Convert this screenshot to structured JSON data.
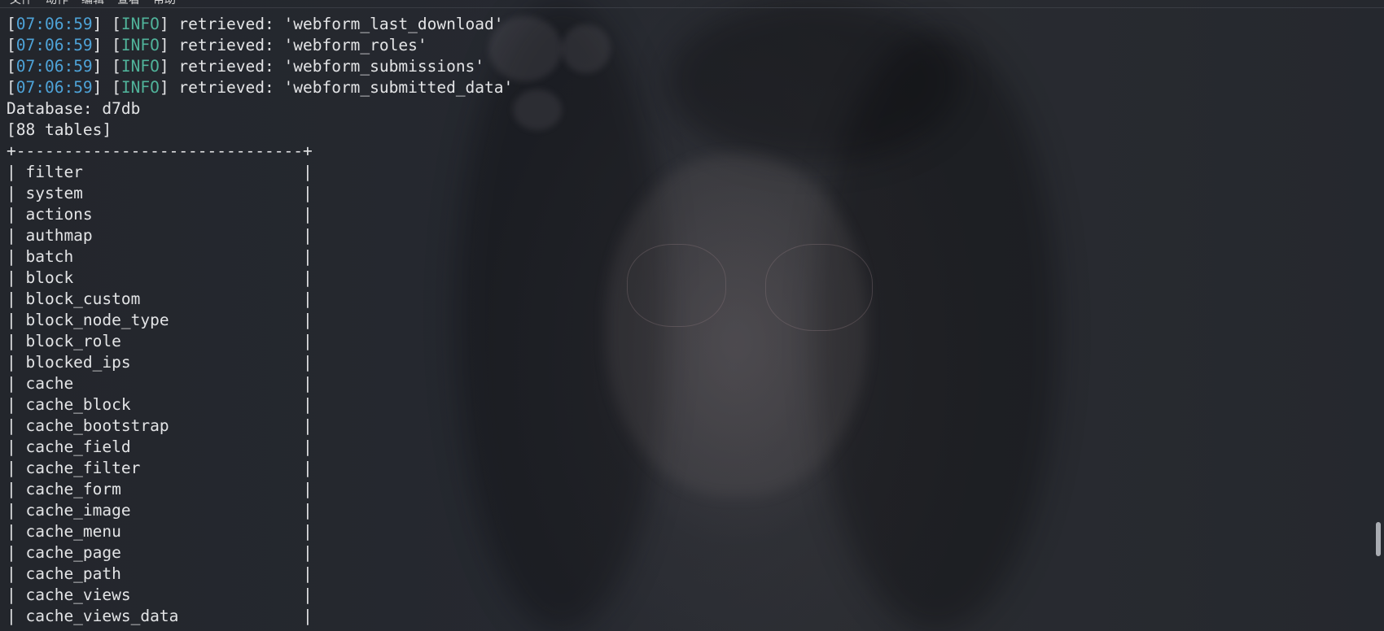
{
  "menu": [
    "文件",
    "动作",
    "编辑",
    "查看",
    "帮助"
  ],
  "colors": {
    "timestamp": "#4ea3d8",
    "level": "#50b39a",
    "text": "#e3e4e6",
    "background": "#23262c"
  },
  "log_lines": [
    {
      "time": "07:06:59",
      "level": "INFO",
      "message": "retrieved: 'webform_last_download'"
    },
    {
      "time": "07:06:59",
      "level": "INFO",
      "message": "retrieved: 'webform_roles'"
    },
    {
      "time": "07:06:59",
      "level": "INFO",
      "message": "retrieved: 'webform_submissions'"
    },
    {
      "time": "07:06:59",
      "level": "INFO",
      "message": "retrieved: 'webform_submitted_data'"
    }
  ],
  "database_line": "Database: d7db",
  "tables_count_line": "[88 tables]",
  "table_border": "+------------------------------+",
  "tables": [
    "filter",
    "system",
    "actions",
    "authmap",
    "batch",
    "block",
    "block_custom",
    "block_node_type",
    "block_role",
    "blocked_ips",
    "cache",
    "cache_block",
    "cache_bootstrap",
    "cache_field",
    "cache_filter",
    "cache_form",
    "cache_image",
    "cache_menu",
    "cache_page",
    "cache_path",
    "cache_views",
    "cache_views_data"
  ]
}
